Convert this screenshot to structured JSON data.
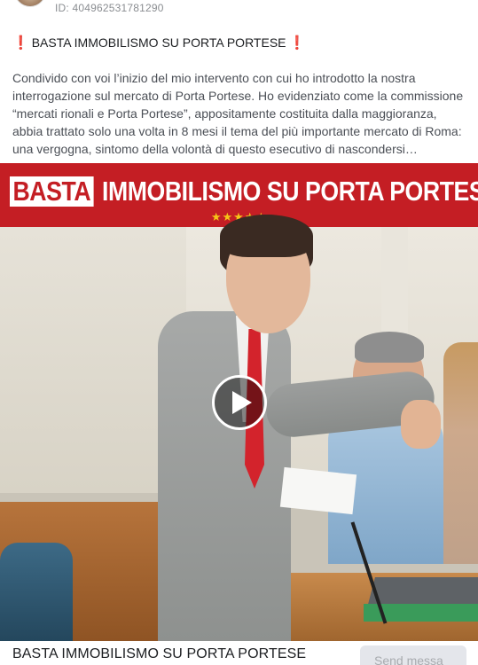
{
  "post": {
    "id_label": "ID: 404962531781290",
    "title_prefix_icon": "❗",
    "title": "BASTA IMMOBILISMO SU PORTA PORTESE",
    "title_suffix_icon": "❗",
    "body": "Condivido con voi l’inizio del mio intervento con cui ho introdotto la nostra interrogazione sul mercato di Porta Portese. Ho evidenziato come la commissione “mercati rionali e Porta Portese”, appositamente costituita dalla maggioranza, abbia trattato solo una volta in 8 mesi il tema del più importante mercato di Roma: una vergogna, sintomo della volontà di questo esecutivo di nascondersi…"
  },
  "video": {
    "banner_word1": "BASTA",
    "banner_rest": "IMMOBILISMO SU PORTA PORTESE",
    "stars": "★★★★★",
    "play_icon": "play-icon"
  },
  "footer": {
    "caption": "BASTA IMMOBILISMO SU PORTA PORTESE",
    "send_label": "Send messa"
  },
  "colors": {
    "banner_red": "#c41e24",
    "star_yellow": "#f5c518",
    "alert_red": "#e0245e"
  }
}
